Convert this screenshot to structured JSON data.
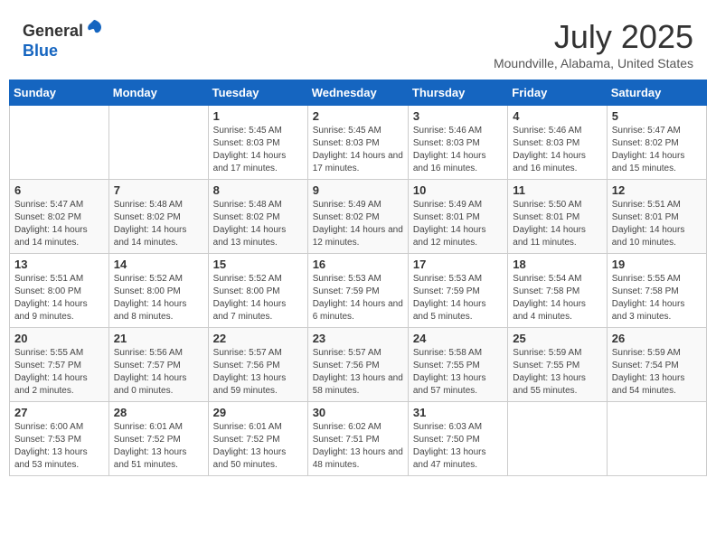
{
  "header": {
    "logo_general": "General",
    "logo_blue": "Blue",
    "month": "July 2025",
    "location": "Moundville, Alabama, United States"
  },
  "weekdays": [
    "Sunday",
    "Monday",
    "Tuesday",
    "Wednesday",
    "Thursday",
    "Friday",
    "Saturday"
  ],
  "weeks": [
    [
      {
        "day": "",
        "info": ""
      },
      {
        "day": "",
        "info": ""
      },
      {
        "day": "1",
        "info": "Sunrise: 5:45 AM\nSunset: 8:03 PM\nDaylight: 14 hours and 17 minutes."
      },
      {
        "day": "2",
        "info": "Sunrise: 5:45 AM\nSunset: 8:03 PM\nDaylight: 14 hours and 17 minutes."
      },
      {
        "day": "3",
        "info": "Sunrise: 5:46 AM\nSunset: 8:03 PM\nDaylight: 14 hours and 16 minutes."
      },
      {
        "day": "4",
        "info": "Sunrise: 5:46 AM\nSunset: 8:03 PM\nDaylight: 14 hours and 16 minutes."
      },
      {
        "day": "5",
        "info": "Sunrise: 5:47 AM\nSunset: 8:02 PM\nDaylight: 14 hours and 15 minutes."
      }
    ],
    [
      {
        "day": "6",
        "info": "Sunrise: 5:47 AM\nSunset: 8:02 PM\nDaylight: 14 hours and 14 minutes."
      },
      {
        "day": "7",
        "info": "Sunrise: 5:48 AM\nSunset: 8:02 PM\nDaylight: 14 hours and 14 minutes."
      },
      {
        "day": "8",
        "info": "Sunrise: 5:48 AM\nSunset: 8:02 PM\nDaylight: 14 hours and 13 minutes."
      },
      {
        "day": "9",
        "info": "Sunrise: 5:49 AM\nSunset: 8:02 PM\nDaylight: 14 hours and 12 minutes."
      },
      {
        "day": "10",
        "info": "Sunrise: 5:49 AM\nSunset: 8:01 PM\nDaylight: 14 hours and 12 minutes."
      },
      {
        "day": "11",
        "info": "Sunrise: 5:50 AM\nSunset: 8:01 PM\nDaylight: 14 hours and 11 minutes."
      },
      {
        "day": "12",
        "info": "Sunrise: 5:51 AM\nSunset: 8:01 PM\nDaylight: 14 hours and 10 minutes."
      }
    ],
    [
      {
        "day": "13",
        "info": "Sunrise: 5:51 AM\nSunset: 8:00 PM\nDaylight: 14 hours and 9 minutes."
      },
      {
        "day": "14",
        "info": "Sunrise: 5:52 AM\nSunset: 8:00 PM\nDaylight: 14 hours and 8 minutes."
      },
      {
        "day": "15",
        "info": "Sunrise: 5:52 AM\nSunset: 8:00 PM\nDaylight: 14 hours and 7 minutes."
      },
      {
        "day": "16",
        "info": "Sunrise: 5:53 AM\nSunset: 7:59 PM\nDaylight: 14 hours and 6 minutes."
      },
      {
        "day": "17",
        "info": "Sunrise: 5:53 AM\nSunset: 7:59 PM\nDaylight: 14 hours and 5 minutes."
      },
      {
        "day": "18",
        "info": "Sunrise: 5:54 AM\nSunset: 7:58 PM\nDaylight: 14 hours and 4 minutes."
      },
      {
        "day": "19",
        "info": "Sunrise: 5:55 AM\nSunset: 7:58 PM\nDaylight: 14 hours and 3 minutes."
      }
    ],
    [
      {
        "day": "20",
        "info": "Sunrise: 5:55 AM\nSunset: 7:57 PM\nDaylight: 14 hours and 2 minutes."
      },
      {
        "day": "21",
        "info": "Sunrise: 5:56 AM\nSunset: 7:57 PM\nDaylight: 14 hours and 0 minutes."
      },
      {
        "day": "22",
        "info": "Sunrise: 5:57 AM\nSunset: 7:56 PM\nDaylight: 13 hours and 59 minutes."
      },
      {
        "day": "23",
        "info": "Sunrise: 5:57 AM\nSunset: 7:56 PM\nDaylight: 13 hours and 58 minutes."
      },
      {
        "day": "24",
        "info": "Sunrise: 5:58 AM\nSunset: 7:55 PM\nDaylight: 13 hours and 57 minutes."
      },
      {
        "day": "25",
        "info": "Sunrise: 5:59 AM\nSunset: 7:55 PM\nDaylight: 13 hours and 55 minutes."
      },
      {
        "day": "26",
        "info": "Sunrise: 5:59 AM\nSunset: 7:54 PM\nDaylight: 13 hours and 54 minutes."
      }
    ],
    [
      {
        "day": "27",
        "info": "Sunrise: 6:00 AM\nSunset: 7:53 PM\nDaylight: 13 hours and 53 minutes."
      },
      {
        "day": "28",
        "info": "Sunrise: 6:01 AM\nSunset: 7:52 PM\nDaylight: 13 hours and 51 minutes."
      },
      {
        "day": "29",
        "info": "Sunrise: 6:01 AM\nSunset: 7:52 PM\nDaylight: 13 hours and 50 minutes."
      },
      {
        "day": "30",
        "info": "Sunrise: 6:02 AM\nSunset: 7:51 PM\nDaylight: 13 hours and 48 minutes."
      },
      {
        "day": "31",
        "info": "Sunrise: 6:03 AM\nSunset: 7:50 PM\nDaylight: 13 hours and 47 minutes."
      },
      {
        "day": "",
        "info": ""
      },
      {
        "day": "",
        "info": ""
      }
    ]
  ]
}
